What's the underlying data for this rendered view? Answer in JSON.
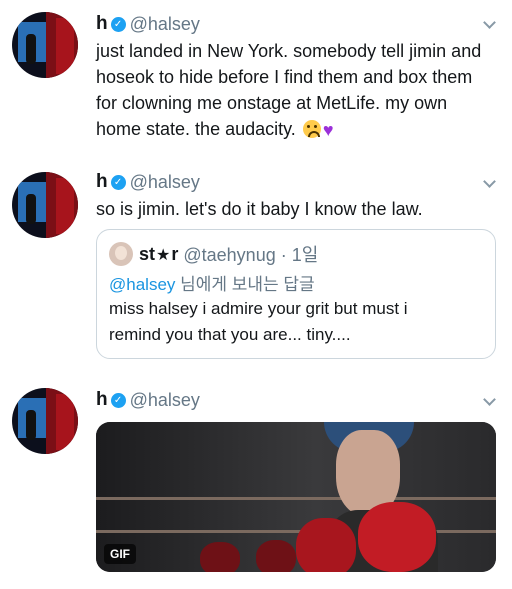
{
  "tweets": [
    {
      "name": "h",
      "handle": "@halsey",
      "text": "just landed in New York. somebody tell jimin and\nhoseok to hide before I find them and box them\nfor clowning me onstage at MetLife. my own\nhome state. the audacity.",
      "emojis": [
        "triumph-face",
        "purple-heart"
      ]
    },
    {
      "name": "h",
      "handle": "@halsey",
      "text": "so is jimin. let's do it baby I know the law.",
      "quote": {
        "name_pre": "st",
        "name_star": "★",
        "name_post": "r",
        "handle_date": "@taehynug · 1일",
        "reply_handle": "@halsey",
        "reply_suffix": " 님에게 보내는 답글",
        "text": "miss halsey i admire your grit but must i\nremind you that you are... tiny...."
      }
    },
    {
      "name": "h",
      "handle": "@halsey",
      "media": {
        "badge": "GIF"
      }
    }
  ],
  "colors": {
    "accent": "#1da1f2",
    "link": "#1b95e0",
    "muted": "#657786",
    "border": "#ccd6dd"
  }
}
